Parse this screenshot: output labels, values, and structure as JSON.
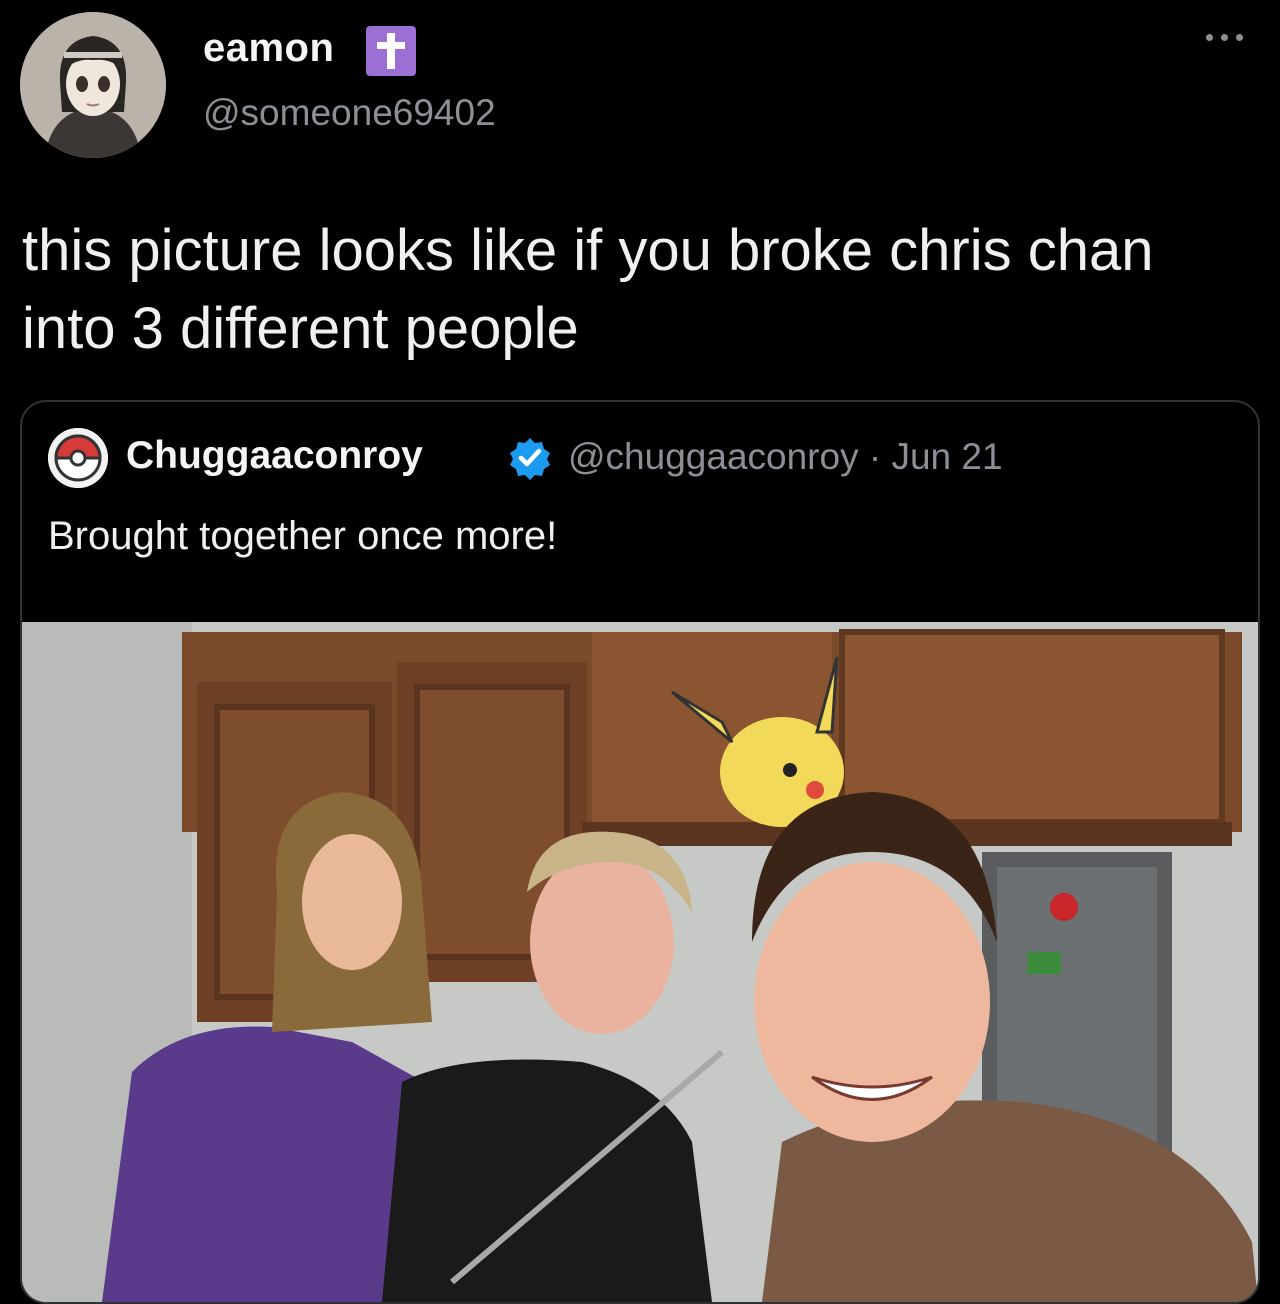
{
  "author": {
    "display_name": "eamon",
    "handle": "@someone69402",
    "avatar_icon": "anime-girl-avatar",
    "badge_icon": "cross-icon"
  },
  "tweet": {
    "text": "this picture looks like if you broke chris chan into 3 different people"
  },
  "quoted_tweet": {
    "display_name": "Chuggaaconroy",
    "verified": true,
    "handle": "@chuggaaconroy",
    "separator": "·",
    "date": "Jun 21",
    "text": "Brought together once more!",
    "media_icon": "group-selfie-photo"
  },
  "colors": {
    "background": "#000000",
    "muted_text": "#8b9096",
    "verified_blue": "#1d9bf0",
    "badge_purple": "#9b6fd3"
  }
}
